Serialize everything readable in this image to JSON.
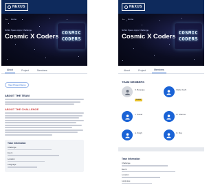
{
  "left": {
    "logo_text": "NEXUS",
    "back_crumb": "Home",
    "subtitle": "NASA Space Apps Challenge",
    "title": "Cosmic X Coders",
    "cosmic_lines": [
      "COSMIC",
      "CODERS"
    ],
    "tabs": [
      "About",
      "Project",
      "Members"
    ],
    "pill": "View Project Demo",
    "about_heading": "ABOUT THE TEAM",
    "challenge_heading": "ABOUT THE CHALLENGE",
    "info_title": "Team Information",
    "info_labels": [
      "Challenge",
      "Event",
      "Location",
      "Language"
    ]
  },
  "right": {
    "logo_text": "NEXUS",
    "back_crumb": "Home",
    "subtitle": "NASA Space Apps Challenge",
    "title": "Cosmic X Coders",
    "cosmic_lines": [
      "COSMIC",
      "CODERS"
    ],
    "tabs": [
      "About",
      "Project",
      "Members"
    ],
    "team_heading": "TEAM MEMBERS",
    "members": [
      {
        "name": "K. Banerjee",
        "badge": "Leader"
      },
      {
        "name": "Rahul Joshi"
      },
      {
        "name": "J. Kumar"
      },
      {
        "name": "R. Sharma"
      },
      {
        "name": "A. Singh"
      },
      {
        "name": "K. Roy"
      }
    ],
    "info_title": "Team Information",
    "info_labels": [
      "Challenge",
      "Event",
      "Location",
      "Language"
    ]
  },
  "colors": {
    "header": "#0e2a5c",
    "accent": "#1a63d6",
    "challenge_heading": "#d04848",
    "badge": "#e8c12a"
  },
  "icons": [
    "back-arrow-icon",
    "user-icon"
  ]
}
